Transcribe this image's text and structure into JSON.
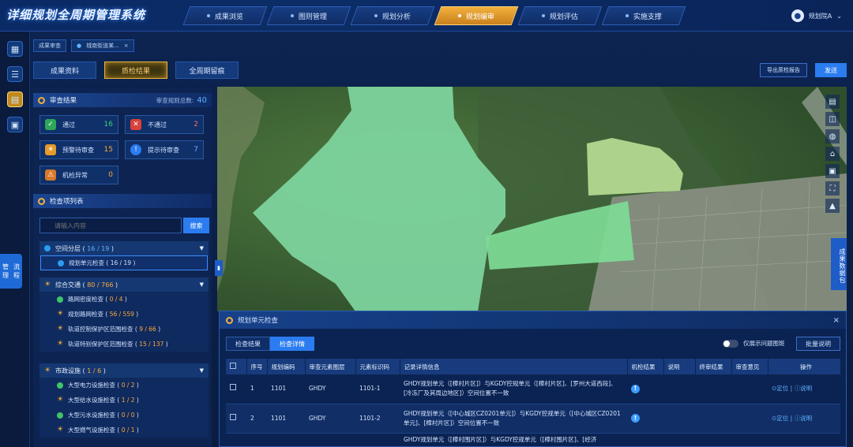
{
  "app": {
    "title": "详细规划全周期管理系统"
  },
  "nav": [
    {
      "label": "成果浏览"
    },
    {
      "label": "图则管理"
    },
    {
      "label": "规划分析"
    },
    {
      "label": "规划编审"
    },
    {
      "label": "规划评估"
    },
    {
      "label": "实施支撑"
    }
  ],
  "user": {
    "name": "规划院A",
    "chevron": "⌄"
  },
  "rail": {
    "flow_label_1": "管理",
    "flow_label_2": "流程"
  },
  "crumbs": [
    {
      "label": "成果审查"
    },
    {
      "label": "城南街道某..."
    }
  ],
  "crumb_close": "×",
  "tabs": [
    {
      "label": "成果资料"
    },
    {
      "label": "质检结果"
    },
    {
      "label": "全周期留痕"
    }
  ],
  "actions": {
    "export": "导出质检报告",
    "send": "发送"
  },
  "review": {
    "title": "审查结果",
    "total_label": "审查规则总数:",
    "total": "40",
    "stats": [
      {
        "label": "通过",
        "count": "16",
        "color": "#2ea65a",
        "icon": "check-icon",
        "glyph": "✓"
      },
      {
        "label": "不通过",
        "count": "2",
        "color": "#d9413a",
        "icon": "cross-icon",
        "glyph": "✕"
      },
      {
        "label": "预警待审查",
        "count": "15",
        "color": "#e59a2a",
        "icon": "sun-warning-icon",
        "glyph": "☀"
      },
      {
        "label": "提示待审查",
        "count": "7",
        "color": "#2b7cf0",
        "icon": "info-icon",
        "glyph": "!"
      },
      {
        "label": "机检异常",
        "count": "0",
        "color": "#d9772a",
        "icon": "machine-error-icon",
        "glyph": "⚠"
      }
    ]
  },
  "checklist": {
    "title": "检查项列表",
    "search_placeholder": "请输入内容",
    "search_button": "搜索",
    "groups": [
      {
        "name": "空间分层",
        "count": "16 / 19",
        "items": [
          {
            "name": "规划单元检查",
            "count": "16 / 19"
          }
        ]
      },
      {
        "name": "综合交通",
        "count": "80 / 766",
        "items": [
          {
            "name": "路网密度检查",
            "count": "0 / 4"
          },
          {
            "name": "规划路网检查",
            "count": "56 / 559"
          },
          {
            "name": "轨道控制保护区范围检查",
            "count": "9 / 66"
          },
          {
            "name": "轨道特别保护区范围检查",
            "count": "15 / 137"
          }
        ]
      },
      {
        "name": "市政设施",
        "count": "1 / 6",
        "items": [
          {
            "name": "大型电力设施检查",
            "count": "0 / 2"
          },
          {
            "name": "大型给水设施检查",
            "count": "1 / 2"
          },
          {
            "name": "大型污水设施检查",
            "count": "0 / 0"
          },
          {
            "name": "大型燃气设施检查",
            "count": "0 / 1"
          }
        ]
      }
    ]
  },
  "map": {
    "colors": {
      "main": "#7fd6a0",
      "right": "#7edb96",
      "pale": "#b6dc93"
    },
    "results_package": "成果数据包"
  },
  "dialog": {
    "title": "规划单元检查",
    "close": "×",
    "tabs": [
      {
        "label": "检查结果"
      },
      {
        "label": "检查详情"
      }
    ],
    "toggle_label": "仅展示问题图斑",
    "batch_button": "批量说明",
    "columns": [
      "序号",
      "规划编码",
      "审查元素图层",
      "元素标识码",
      "记录详情信息",
      "机检结果",
      "说明",
      "终审结果",
      "审查意见",
      "操作"
    ],
    "rows": [
      {
        "no": "1",
        "code": "1101",
        "layer": "GHDY",
        "element": "1101-1",
        "detail": "GHDY规划单元（[樟村片区]）与KGDY控规单元（[樟村片区]、[罗州大道西段]、[冷冻厂及其周边地区]）空间位置不一致",
        "locate": "定位",
        "explain": "说明"
      },
      {
        "no": "2",
        "code": "1101",
        "layer": "GHDY",
        "element": "1101-2",
        "detail": "GHDY规划单元（[中心城区CZ0201单元]）与KGDY控规单元（[中心城区CZ0201单元]、[樟村片区]）空间位置不一致",
        "locate": "定位",
        "explain": "说明"
      },
      {
        "no": "",
        "code": "",
        "layer": "",
        "element": "",
        "detail": "GHDY规划单元（[樟村围片区]）与KGDY控规单元（[樟村围片区]、[经济",
        "locate": "",
        "explain": ""
      }
    ]
  }
}
